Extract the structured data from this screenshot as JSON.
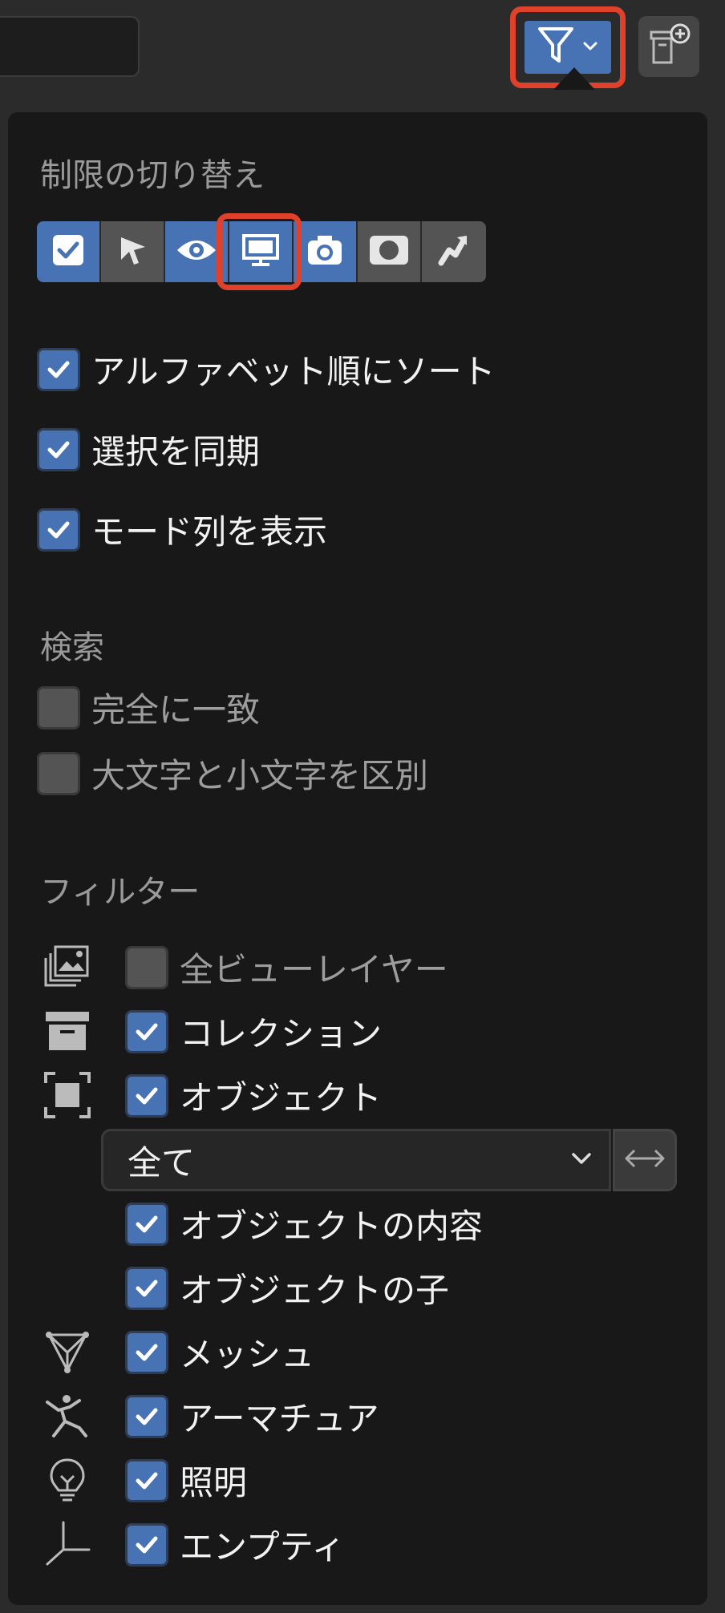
{
  "header": {
    "filter_button": {
      "icon": "funnel-icon",
      "chevron": "chevron-down-icon",
      "active": true
    },
    "new_collection_button": {
      "icon": "new-collection-icon"
    }
  },
  "restriction_toggles": {
    "title": "制限の切り替え",
    "items": [
      {
        "icon": "checkbox-icon",
        "enabled": true
      },
      {
        "icon": "select-cursor-icon",
        "enabled": false
      },
      {
        "icon": "eye-icon",
        "enabled": true
      },
      {
        "icon": "monitor-icon",
        "enabled": true
      },
      {
        "icon": "camera-icon",
        "enabled": true
      },
      {
        "icon": "holdout-icon",
        "enabled": false
      },
      {
        "icon": "indirect-only-icon",
        "enabled": false
      }
    ]
  },
  "options": [
    {
      "label": "アルファベット順にソート",
      "checked": true
    },
    {
      "label": "選択を同期",
      "checked": true
    },
    {
      "label": "モード列を表示",
      "checked": true
    }
  ],
  "search": {
    "title": "検索",
    "items": [
      {
        "label": "完全に一致",
        "checked": false
      },
      {
        "label": "大文字と小文字を区別",
        "checked": false
      }
    ]
  },
  "filter": {
    "title": "フィルター",
    "items": [
      {
        "label": "全ビューレイヤー",
        "checked": false,
        "icon": "view-layers-icon"
      },
      {
        "label": "コレクション",
        "checked": true,
        "icon": "collection-icon"
      },
      {
        "label": "オブジェクト",
        "checked": true,
        "icon": "object-icon"
      }
    ],
    "object_dropdown": {
      "value": "全て",
      "swap_icon": "swap-arrows-icon"
    },
    "object_sub_items": [
      {
        "label": "オブジェクトの内容",
        "checked": true
      },
      {
        "label": "オブジェクトの子",
        "checked": true
      }
    ],
    "type_items": [
      {
        "label": "メッシュ",
        "checked": true,
        "icon": "mesh-icon"
      },
      {
        "label": "アーマチュア",
        "checked": true,
        "icon": "armature-icon"
      },
      {
        "label": "照明",
        "checked": true,
        "icon": "light-bulb-icon"
      },
      {
        "label": "エンプティ",
        "checked": true,
        "icon": "empty-axes-icon"
      }
    ]
  },
  "colors": {
    "accent": "#4772b3",
    "highlight": "#e0412b",
    "panel": "#181818"
  }
}
